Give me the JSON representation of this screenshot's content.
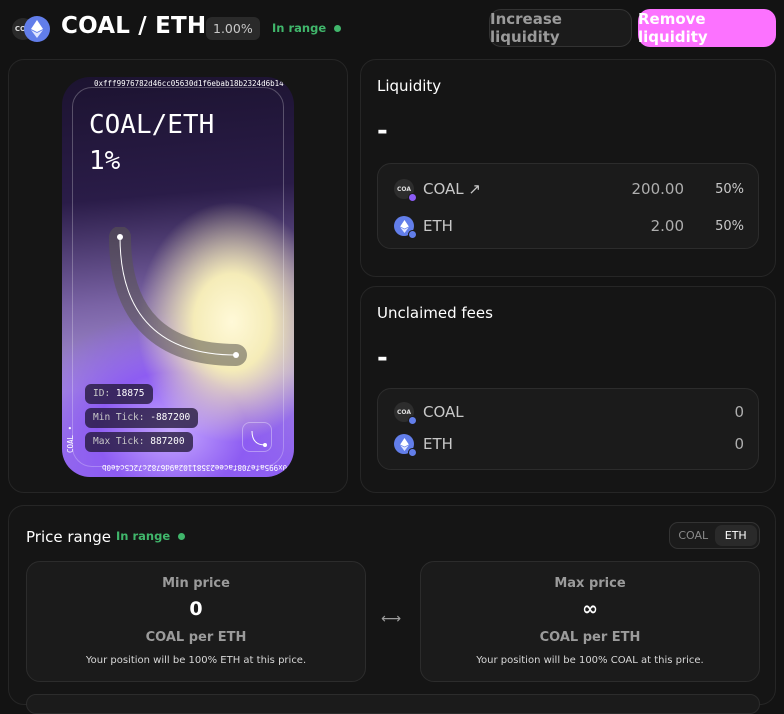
{
  "header": {
    "title": "COAL / ETH",
    "fee_tier": "1.00%",
    "range_status": "In range",
    "increase_label": "Increase liquidity",
    "remove_label": "Remove liquidity",
    "coal_icon_text": "COA"
  },
  "nft": {
    "title_line1": "COAL/ETH",
    "title_line2": "1%",
    "edge_top": "0xfff9976782d46cc05630d1f6ebab18b2324d6b14 • ETH",
    "edge_bottom": "0x995afe708facee23581102a9d6782c72C5c4e0b",
    "edge_right": "",
    "edge_left": "COAL •",
    "id_key": "ID:",
    "id_val": "18875",
    "min_key": "Min Tick:",
    "min_val": "-887200",
    "max_key": "Max Tick:",
    "max_val": "887200"
  },
  "liquidity": {
    "title": "Liquidity",
    "value": "-",
    "rows": [
      {
        "symbol": "COAL ↗",
        "amount": "200.00",
        "percent": "50%",
        "icon_text": "COA"
      },
      {
        "symbol": "ETH",
        "amount": "2.00",
        "percent": "50%"
      }
    ]
  },
  "fees": {
    "title": "Unclaimed fees",
    "value": "-",
    "rows": [
      {
        "symbol": "COAL",
        "amount": "0",
        "icon_text": "COA"
      },
      {
        "symbol": "ETH",
        "amount": "0"
      }
    ]
  },
  "price_range": {
    "title": "Price range",
    "status": "In range",
    "toggle": [
      "COAL",
      "ETH"
    ],
    "toggle_selected": "ETH",
    "min": {
      "label": "Min price",
      "value": "0",
      "unit": "COAL per ETH",
      "note": "Your position will be 100% ETH at this price."
    },
    "max": {
      "label": "Max price",
      "value": "∞",
      "unit": "COAL per ETH",
      "note": "Your position will be 100% COAL at this price."
    },
    "arrow": "⟷"
  },
  "colors": {
    "accent_pink": "#fc72ff",
    "in_range_green": "#40b66b",
    "eth_blue": "#627eea"
  }
}
